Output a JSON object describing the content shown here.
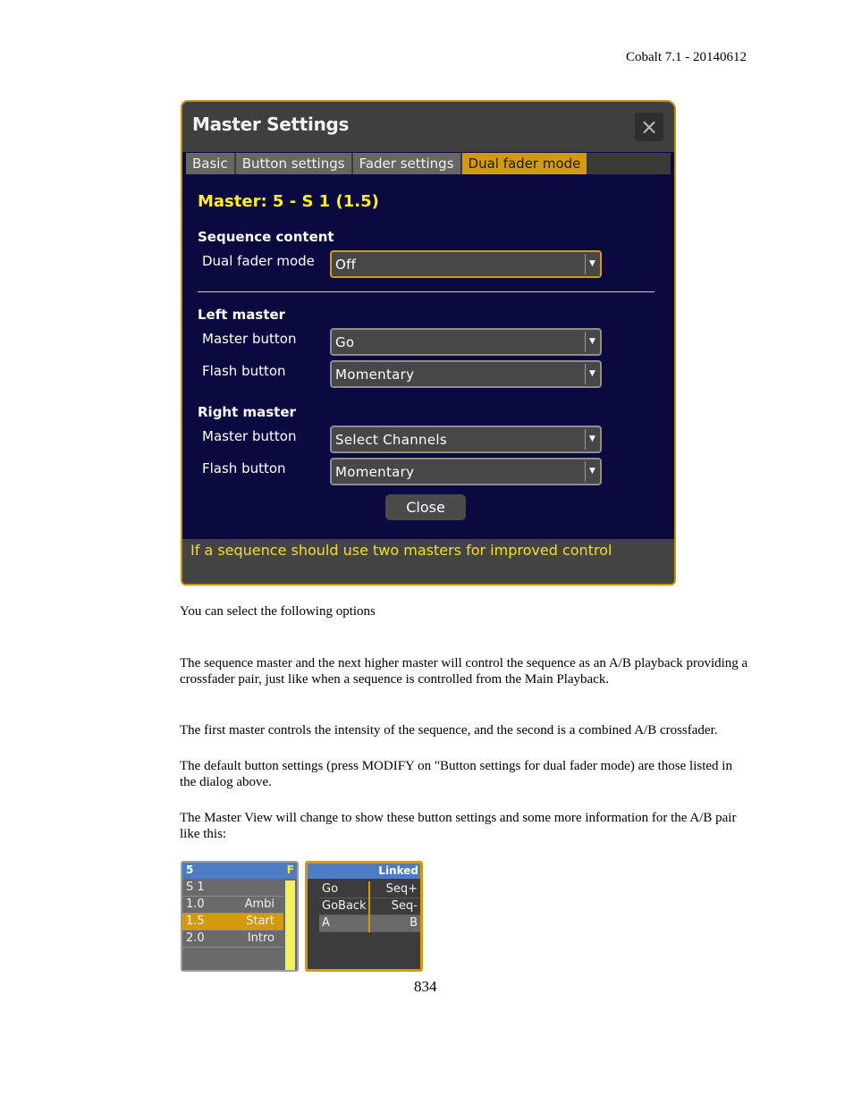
{
  "page": {
    "header": "Cobalt 7.1 - 20140612",
    "page_number": "834",
    "paragraphs": [
      "You can select the following options",
      "The sequence master and the next higher master will control the sequence as an A/B playback providing a crossfader pair, just like when a sequence is controlled from the Main Playback.",
      "The first master controls the intensity of the sequence, and the second is a combined A/B crossfader.",
      "The default button settings (press MODIFY on \"Button settings for dual fader mode) are those listed in the dialog above.",
      "The Master View will change to show these button settings and some more information for the A/B pair like this:"
    ]
  },
  "dialog": {
    "title": "Master Settings",
    "close_icon": "×",
    "tabs": [
      {
        "label": "Basic",
        "active": false
      },
      {
        "label": "Button settings",
        "active": false
      },
      {
        "label": "Fader settings",
        "active": false
      },
      {
        "label": "Dual fader mode",
        "active": true
      }
    ],
    "master_heading": "Master: 5 - S 1 (1.5)",
    "sequence_content": {
      "heading": "Sequence content",
      "dual_fader_mode": {
        "label": "Dual fader mode",
        "value": "Off"
      }
    },
    "left_master": {
      "heading": "Left master",
      "master_button": {
        "label": "Master button",
        "value": "Go"
      },
      "flash_button": {
        "label": "Flash button",
        "value": "Momentary"
      }
    },
    "right_master": {
      "heading": "Right master",
      "master_button": {
        "label": "Master button",
        "value": "Select Channels"
      },
      "flash_button": {
        "label": "Flash button",
        "value": "Momentary"
      }
    },
    "dropdown_arrow": "▼",
    "close_button": "Close",
    "status_text": "If a sequence should use two masters for improved control",
    "accent_color": "#d29a0c",
    "heading_color": "#ffee22"
  },
  "master_view": {
    "left": {
      "number": "5",
      "flag": "F",
      "rows": [
        {
          "c1": "S  1",
          "c2": "",
          "active": false
        },
        {
          "c1": "1.0",
          "c2": "Ambi",
          "active": false
        },
        {
          "c1": "1.5",
          "c2": "Start",
          "active": true
        },
        {
          "c1": "2.0",
          "c2": "Intro",
          "active": false
        }
      ]
    },
    "right": {
      "header": "Linked",
      "rows": [
        {
          "c1": "Go",
          "c2": "Seq+"
        },
        {
          "c1": "GoBack",
          "c2": "Seq-"
        },
        {
          "c1": "A",
          "c2": "B"
        }
      ]
    }
  }
}
